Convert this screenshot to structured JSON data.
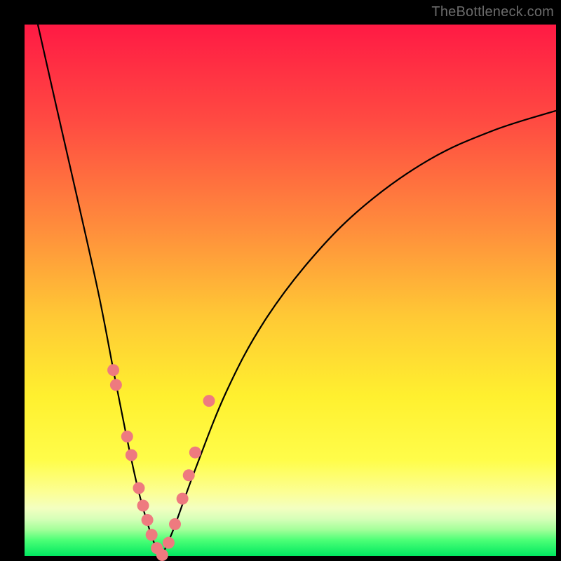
{
  "watermark": "TheBottleneck.com",
  "chart_data": {
    "type": "line",
    "title": "",
    "xlabel": "",
    "ylabel": "",
    "xlim": [
      0,
      1
    ],
    "ylim": [
      0,
      1
    ],
    "series": [
      {
        "name": "curve-left",
        "x": [
          0.025,
          0.06,
          0.1,
          0.14,
          0.17,
          0.195,
          0.215,
          0.235,
          0.25,
          0.258
        ],
        "values": [
          1.0,
          0.845,
          0.67,
          0.49,
          0.335,
          0.21,
          0.12,
          0.05,
          0.01,
          0.0
        ]
      },
      {
        "name": "curve-right",
        "x": [
          0.258,
          0.28,
          0.32,
          0.38,
          0.45,
          0.54,
          0.64,
          0.76,
          0.88,
          1.0
        ],
        "values": [
          0.0,
          0.05,
          0.16,
          0.31,
          0.44,
          0.56,
          0.66,
          0.745,
          0.8,
          0.838
        ]
      }
    ],
    "markers": {
      "name": "highlight-dots",
      "color": "#ee7a7f",
      "x": [
        0.167,
        0.172,
        0.193,
        0.201,
        0.215,
        0.223,
        0.231,
        0.239,
        0.249,
        0.259,
        0.271,
        0.283,
        0.297,
        0.309,
        0.321,
        0.347
      ],
      "values": [
        0.35,
        0.322,
        0.225,
        0.19,
        0.128,
        0.095,
        0.068,
        0.04,
        0.015,
        0.002,
        0.025,
        0.06,
        0.108,
        0.152,
        0.195,
        0.292
      ]
    }
  },
  "colors": {
    "curve": "#000000",
    "marker": "#ee7a7f",
    "background_top": "#ff1a44",
    "background_bottom": "#00e860"
  }
}
